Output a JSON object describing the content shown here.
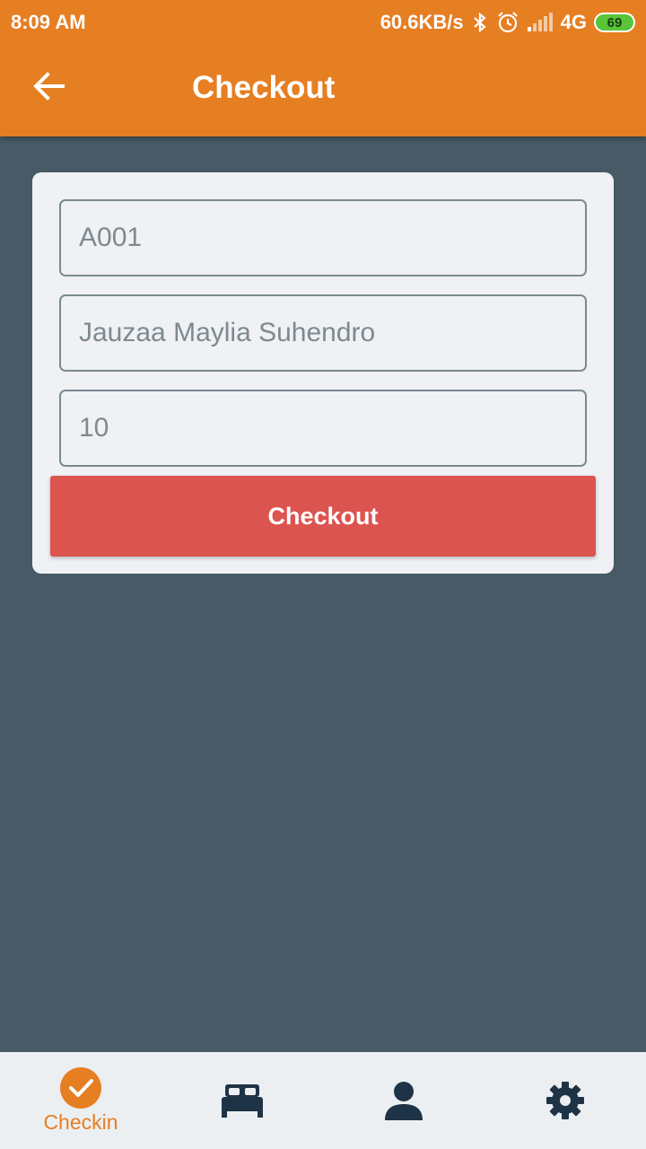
{
  "status_bar": {
    "time": "8:09 AM",
    "net_speed": "60.6KB/s",
    "network": "4G",
    "battery": "69"
  },
  "app_bar": {
    "title": "Checkout",
    "back_icon": "arrow-back-icon"
  },
  "form": {
    "room_code": "A001",
    "guest_name": "Jauzaa Maylia Suhendro",
    "quantity": "10",
    "submit_label": "Checkout"
  },
  "bottom_nav": {
    "items": [
      {
        "label": "Checkin",
        "icon": "check-circle-icon",
        "active": true
      },
      {
        "label": "",
        "icon": "bed-icon",
        "active": false
      },
      {
        "label": "",
        "icon": "person-icon",
        "active": false
      },
      {
        "label": "",
        "icon": "gear-icon",
        "active": false
      }
    ]
  },
  "colors": {
    "primary": "#e67e22",
    "background": "#485a66",
    "button": "#dc5450",
    "nav_icon": "#1f3347"
  }
}
